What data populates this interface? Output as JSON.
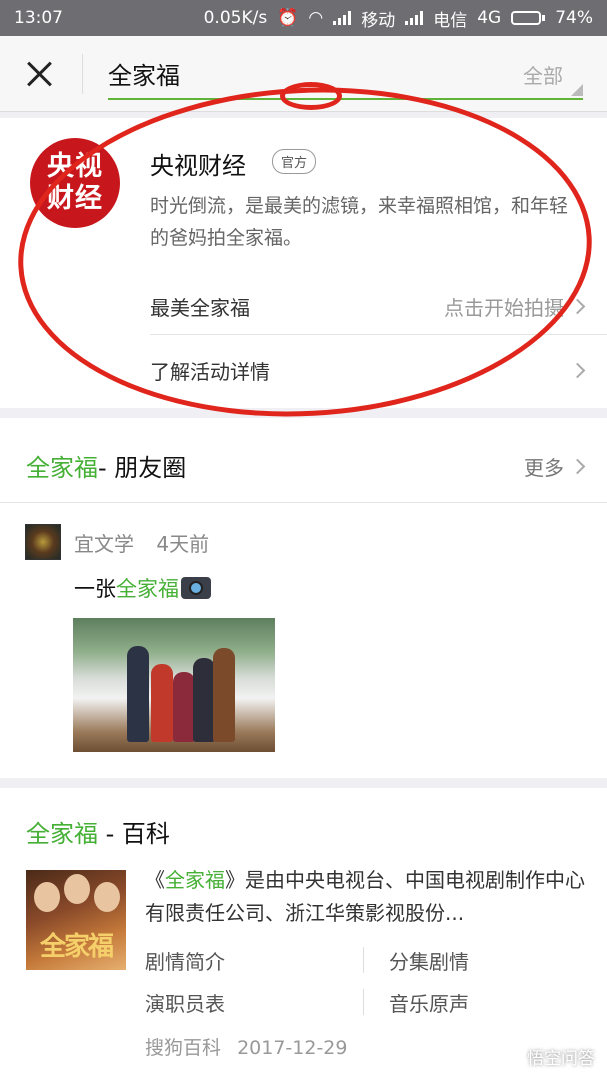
{
  "status_bar": {
    "time": "13:07",
    "speed": "0.05K/s",
    "carrier1": "移动",
    "carrier2": "电信",
    "network": "4G",
    "battery": "74%",
    "battery_level": 0.74
  },
  "search": {
    "query": "全家福",
    "scope": "全部"
  },
  "official_account": {
    "logo_line1": "央视",
    "logo_line2": "财经",
    "name": "央视财经",
    "badge": "官方",
    "description": "时光倒流，是最美的滤镜，来幸福照相馆，和年轻的爸妈拍全家福。",
    "row1_left": "最美全家福",
    "row1_right": "点击开始拍摄",
    "row2": "了解活动详情"
  },
  "moments": {
    "title_keyword": "全家福",
    "title_suffix": "- 朋友圈",
    "more": "更多",
    "author": "宜文学",
    "time": "4天前",
    "post_prefix": "一张",
    "post_keyword": "全家福"
  },
  "baike": {
    "title_keyword": "全家福",
    "title_suffix": " - 百科",
    "cover_text": "全家福",
    "desc_open": "《",
    "desc_keyword": "全家福",
    "desc_rest": "》是由中央电视台、中国电视剧制作中心有限责任公司、浙江华策影视股份...",
    "links": [
      "剧情简介",
      "分集剧情",
      "演职员表",
      "音乐原声"
    ],
    "source": "搜狗百科",
    "date": "2017-12-29"
  },
  "watermark": "悟空问答",
  "colors": {
    "highlight": "#45b035",
    "annotation": "#e0251c",
    "logo": "#c8161d"
  }
}
